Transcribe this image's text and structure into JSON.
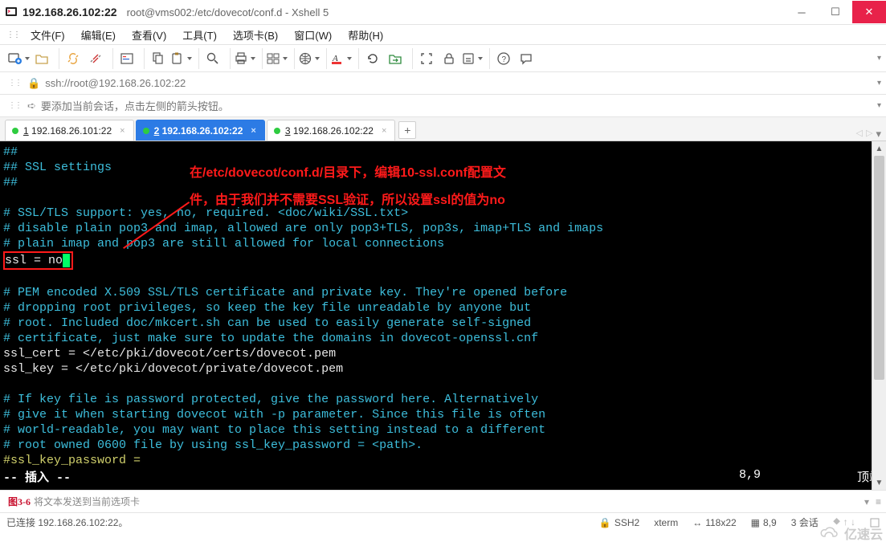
{
  "title_bar": {
    "ip_port": "192.168.26.102:22",
    "path_title": "root@vms002:/etc/dovecot/conf.d - Xshell 5"
  },
  "menu": {
    "file": "文件(F)",
    "edit": "编辑(E)",
    "view": "查看(V)",
    "tool": "工具(T)",
    "tabs": "选项卡(B)",
    "window": "窗口(W)",
    "help": "帮助(H)"
  },
  "address": {
    "url": "ssh://root@192.168.26.102:22"
  },
  "hint": {
    "text": "要添加当前会话，点击左侧的箭头按钮。"
  },
  "tabs": [
    {
      "index": "1",
      "label": "192.168.26.101:22",
      "active": false
    },
    {
      "index": "2",
      "label": "192.168.26.102:22",
      "active": true
    },
    {
      "index": "3",
      "label": "192.168.26.102:22",
      "active": false
    }
  ],
  "annotation": {
    "line1": "在/etc/dovecot/conf.d/目录下，编辑10-ssl.conf配置文",
    "line2": "件，由于我们并不需要SSL验证，所以设置ssl的值为no"
  },
  "terminal_lines": [
    {
      "cls": "c-cyan",
      "text": "##"
    },
    {
      "cls": "c-cyan",
      "text": "## SSL settings"
    },
    {
      "cls": "c-cyan",
      "text": "##"
    },
    {
      "cls": "",
      "text": ""
    },
    {
      "cls": "c-cyan",
      "text": "# SSL/TLS support: yes, no, required. <doc/wiki/SSL.txt>"
    },
    {
      "cls": "c-cyan",
      "text": "# disable plain pop3 and imap, allowed are only pop3+TLS, pop3s, imap+TLS and imaps"
    },
    {
      "cls": "c-cyan",
      "text": "# plain imap and pop3 are still allowed for local connections"
    },
    {
      "cls": "c-white",
      "text": "ssl = no",
      "highlight": true
    },
    {
      "cls": "",
      "text": ""
    },
    {
      "cls": "c-cyan",
      "text": "# PEM encoded X.509 SSL/TLS certificate and private key. They're opened before"
    },
    {
      "cls": "c-cyan",
      "text": "# dropping root privileges, so keep the key file unreadable by anyone but"
    },
    {
      "cls": "c-cyan",
      "text": "# root. Included doc/mkcert.sh can be used to easily generate self-signed"
    },
    {
      "cls": "c-cyan",
      "text": "# certificate, just make sure to update the domains in dovecot-openssl.cnf"
    },
    {
      "cls": "c-white",
      "text": "ssl_cert = </etc/pki/dovecot/certs/dovecot.pem"
    },
    {
      "cls": "c-white",
      "text": "ssl_key = </etc/pki/dovecot/private/dovecot.pem"
    },
    {
      "cls": "",
      "text": ""
    },
    {
      "cls": "c-cyan",
      "text": "# If key file is password protected, give the password here. Alternatively"
    },
    {
      "cls": "c-cyan",
      "text": "# give it when starting dovecot with -p parameter. Since this file is often"
    },
    {
      "cls": "c-cyan",
      "text": "# world-readable, you may want to place this setting instead to a different"
    },
    {
      "cls": "c-cyan",
      "text": "# root owned 0600 file by using ssl_key_password = <path>."
    },
    {
      "cls": "c-yellow",
      "text": "#ssl_key_password ="
    }
  ],
  "editor_status": {
    "mode": "-- 插入 --",
    "cursor": "8,9",
    "position": "顶端"
  },
  "figure_label": "图3-6",
  "input_bar": {
    "placeholder": "将文本发送到当前选项卡"
  },
  "status_bar": {
    "connected": "已连接 192.168.26.102:22。",
    "proto": "SSH2",
    "term_type": "xterm",
    "size": "118x22",
    "rowcol": "8,9",
    "sessions": "3 会话",
    "caps_icon": true
  },
  "watermark": "亿速云"
}
